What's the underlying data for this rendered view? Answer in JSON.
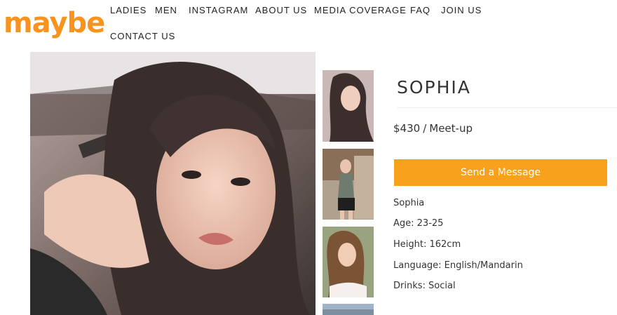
{
  "brand": {
    "logo_text": "maybe",
    "accent_color": "#f7931e"
  },
  "nav": {
    "items": [
      "LADIES",
      "MEN",
      "INSTAGRAM",
      "ABOUT US",
      "MEDIA COVERAGE",
      "FAQ",
      "JOIN US",
      "CONTACT US"
    ]
  },
  "profile": {
    "name": "SOPHIA",
    "price_amount": "$430",
    "price_separator": "/",
    "price_unit": "Meet-up",
    "cta_label": "Send a Message",
    "cta_color": "#f8a11d",
    "details": {
      "display_name": "Sophia",
      "age": "Age: 23-25",
      "height": "Height: 162cm",
      "language": "Language: English/Mandarin",
      "drinks": "Drinks: Social"
    }
  },
  "gallery": {
    "main_photo": "portrait-photo",
    "thumbnails": [
      "thumbnail-photo-1",
      "thumbnail-photo-2",
      "thumbnail-photo-3",
      "thumbnail-photo-4"
    ]
  }
}
